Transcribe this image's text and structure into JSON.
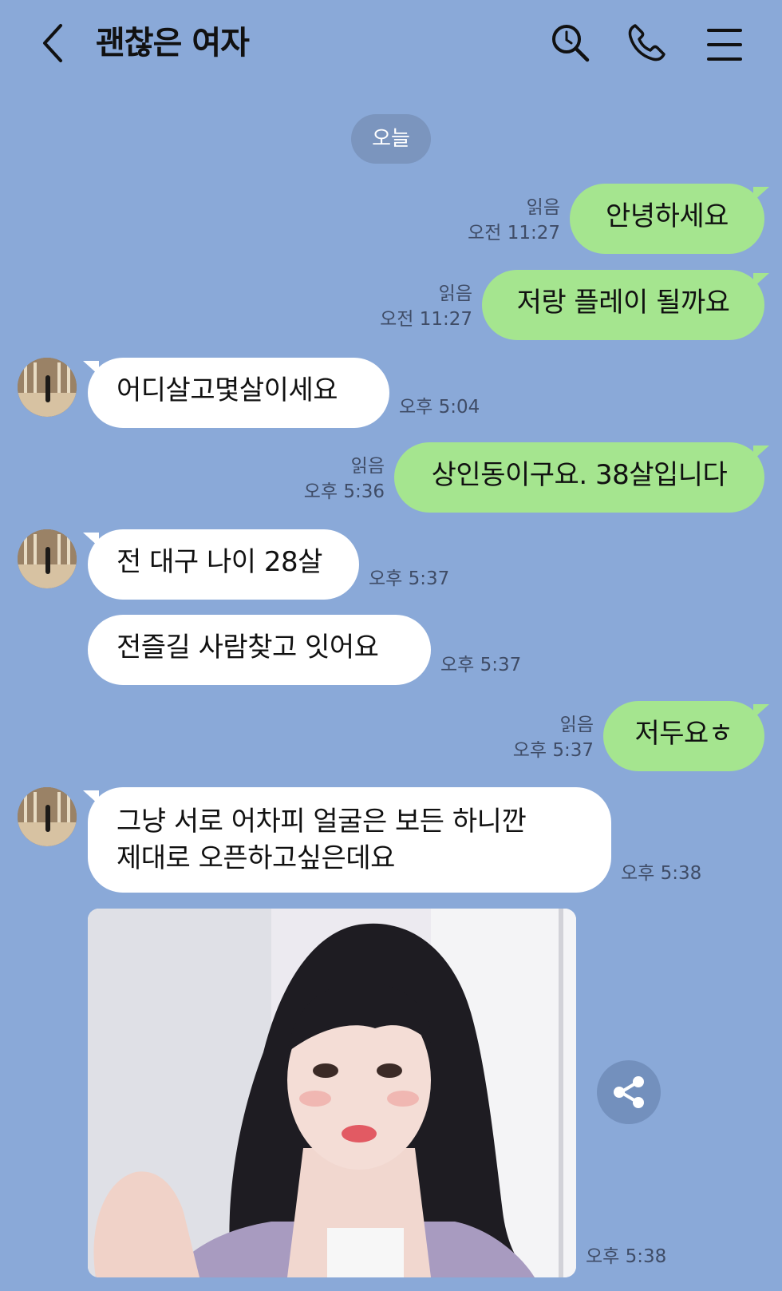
{
  "header": {
    "title": "괜찮은 여자",
    "back_icon": "chevron-left-icon",
    "search_icon": "search-icon",
    "call_icon": "phone-icon",
    "menu_icon": "menu-icon"
  },
  "date_chip": "오늘",
  "messages": [
    {
      "side": "out",
      "text": "안녕하세요",
      "read": "읽음",
      "time": "오전 11:27"
    },
    {
      "side": "out",
      "text": "저랑 플레이 될까요",
      "read": "읽음",
      "time": "오전 11:27"
    },
    {
      "side": "in",
      "text": "어디살고몇살이세요",
      "time": "오후 5:04"
    },
    {
      "side": "out",
      "text": "상인동이구요. 38살입니다",
      "read": "읽음",
      "time": "오후 5:36"
    },
    {
      "side": "in",
      "text": "전 대구 나이 28살",
      "time": "오후 5:37"
    },
    {
      "side": "in",
      "text": "전즐길 사람찾고 잇어요",
      "time": "오후 5:37"
    },
    {
      "side": "out",
      "text": "저두요ㅎ",
      "read": "읽음",
      "time": "오후 5:37"
    },
    {
      "side": "in",
      "text_line1": "그냥 서로 어차피 얼굴은 보든 하니깐",
      "text_line2": "제대로 오픈하고싶은데요",
      "time": "오후 5:38"
    },
    {
      "side": "in",
      "type": "photo",
      "time": "오후 5:38",
      "share_icon": "share-icon"
    }
  ],
  "colors": {
    "background": "#8aa9d8",
    "outgoing_bubble": "#a5e58f",
    "incoming_bubble": "#ffffff",
    "date_chip": "#7b95be"
  }
}
